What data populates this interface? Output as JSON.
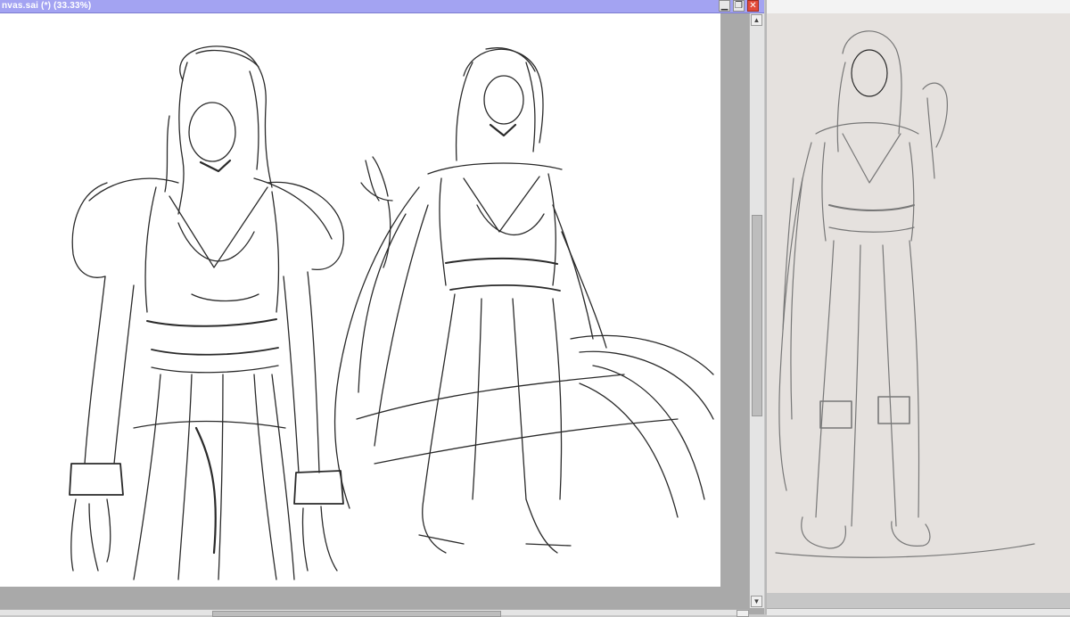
{
  "window": {
    "title": "nvas.sai (*) (33.33%)",
    "minimize_glyph": "▁",
    "maximize_glyph": "❐",
    "close_glyph": "✕"
  },
  "colors": {
    "titlebar": "#a3a3f2",
    "canvas_bg": "#ffffff",
    "workspace": "#a9a9a9",
    "reference_bg": "#e5e1de",
    "close_button": "#e24b3a"
  },
  "icons": {
    "scroll_up": "▲",
    "scroll_down": "▼"
  }
}
